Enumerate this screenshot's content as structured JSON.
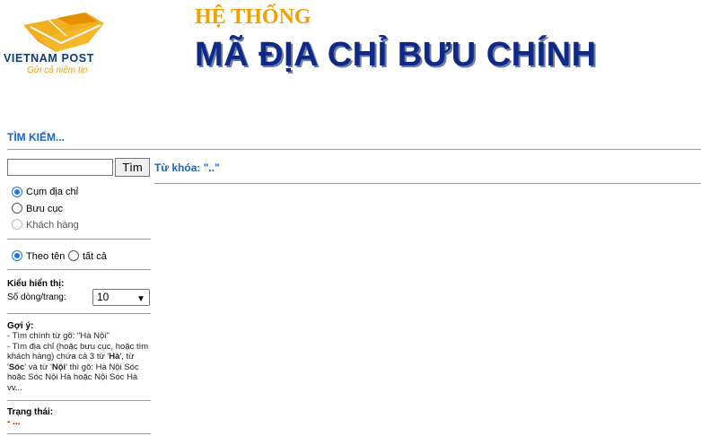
{
  "header": {
    "logo_word": "VIETNAM POST",
    "logo_tagline": "Gửi cả niềm tin",
    "title_small": "HỆ THỐNG",
    "title_big": "MÃ ĐỊA CHỈ BƯU CHÍNH"
  },
  "search": {
    "heading": "TÌM KIẾM...",
    "input_value": "",
    "button_label": "Tìm",
    "keyword_line": "Từ khóa: \"..\""
  },
  "types": [
    {
      "label": "Cụm địa chỉ",
      "checked": true,
      "disabled": false
    },
    {
      "label": "Bưu cục",
      "checked": false,
      "disabled": false
    },
    {
      "label": "Khách hàng",
      "checked": false,
      "disabled": true
    }
  ],
  "mode": {
    "by_name": "Theo tên",
    "all": "tất cả",
    "selected": "by_name"
  },
  "display": {
    "heading": "Kiểu hiển thị:",
    "rows_label": "Số dòng/trang:",
    "rows_value": "10"
  },
  "hints": {
    "heading": "Gợi ý:",
    "line1": "- Tìm chính từ gõ: \"Hà Nội\"",
    "line2_a": "- Tìm địa chỉ (hoặc bưu cục, hoặc tìm khách hàng) chứa cả 3 từ '",
    "w1": "Hà",
    "sep1": "', từ '",
    "w2": "Sóc",
    "sep2": "' và từ '",
    "w3": "Nội",
    "line2_b": "' thì gõ: Hà Nội Sóc hoặc Sóc Nội Hà hoặc Nội Sóc Hà vv..."
  },
  "status": {
    "heading": "Trạng thái:",
    "value": "- ..."
  },
  "colors": {
    "accent_blue": "#1566c0",
    "title_navy": "#0f2a86",
    "title_orange": "#f0a000",
    "status_red": "#d00000"
  }
}
